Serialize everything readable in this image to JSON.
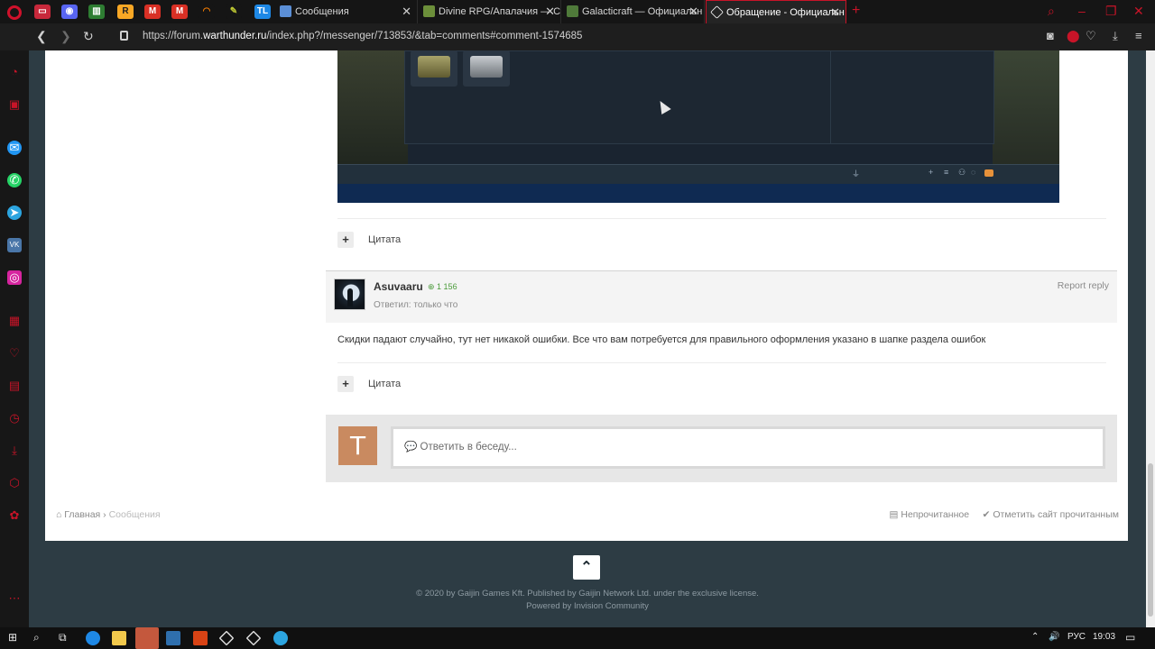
{
  "browser": {
    "tabs": [
      {
        "label": "Сообщения",
        "favicon_color": "#5b8fd6"
      },
      {
        "label": "Divine RPG/Апалачия — С",
        "favicon_color": "#6c8f3a"
      },
      {
        "label": "Galacticraft — Официальн",
        "favicon_color": "#4f7a3a"
      },
      {
        "label": "Обращение - Официальн",
        "favicon_color": "#ffffff",
        "active": true
      }
    ],
    "url_prefix": "https://forum.",
    "url_domain": "warthunder.ru",
    "url_rest": "/index.php?/messenger/713853/&tab=comments#comment-1574685"
  },
  "post": {
    "quote_label": "Цитата",
    "author": "Asuvaaru",
    "reputation": "1 156",
    "reply_meta": "Ответил: только что",
    "report_label": "Report reply",
    "text": "Скидки падают случайно, тут нет никакой ошибки. Все что вам потребуется для правильного оформления указано в шапке раздела ошибок",
    "quote_label_2": "Цитата"
  },
  "reply": {
    "avatar_letter": "T",
    "placeholder": "Ответить в беседу..."
  },
  "breadcrumb": {
    "home": "Главная",
    "current": "Сообщения"
  },
  "footer_links": {
    "unread": "Непрочитанное",
    "mark_read": "Отметить сайт прочитанным"
  },
  "copyright": {
    "line1": "© 2020 by Gaijin Games Kft. Published by Gaijin Network Ltd. under the exclusive license.",
    "line2": "Powered by Invision Community"
  },
  "taskbar": {
    "lang": "РУС",
    "time": "19:03"
  },
  "colors": {
    "brand_red": "#c81428",
    "page_bg": "#2d3c44",
    "reputation_green": "#4a9a3a",
    "avatar_orange": "#c98a60"
  }
}
